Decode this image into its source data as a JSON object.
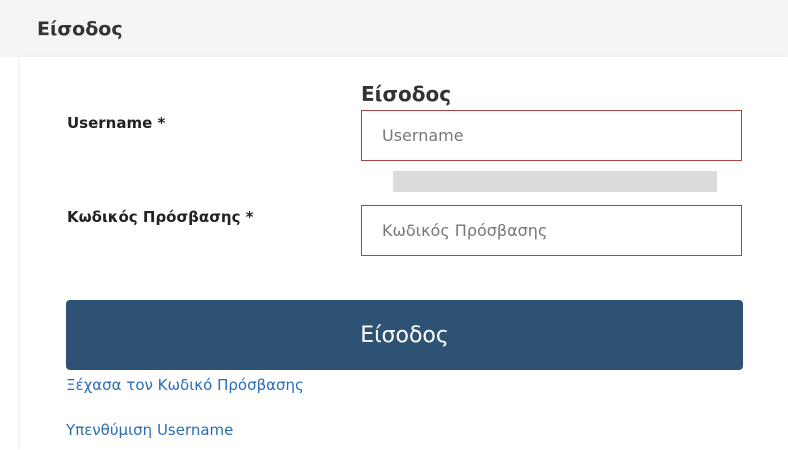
{
  "header": {
    "title": "Είσοδος"
  },
  "form": {
    "heading": "Είσοδος",
    "username": {
      "label": "Username *",
      "placeholder": "Username",
      "value": ""
    },
    "password": {
      "label": "Κωδικός Πρόσβασης *",
      "placeholder": "Κωδικός Πρόσβασης",
      "value": ""
    },
    "submit_label": "Είσοδος"
  },
  "links": {
    "forgot_password": "Ξέχασα τον Κωδικό Πρόσβασης",
    "username_reminder": "Υπενθύμιση Username"
  },
  "colors": {
    "header_bg": "#f5f5f5",
    "input_border_error": "#a94442",
    "button_bg": "#2e5273",
    "link": "#2a6db5"
  }
}
